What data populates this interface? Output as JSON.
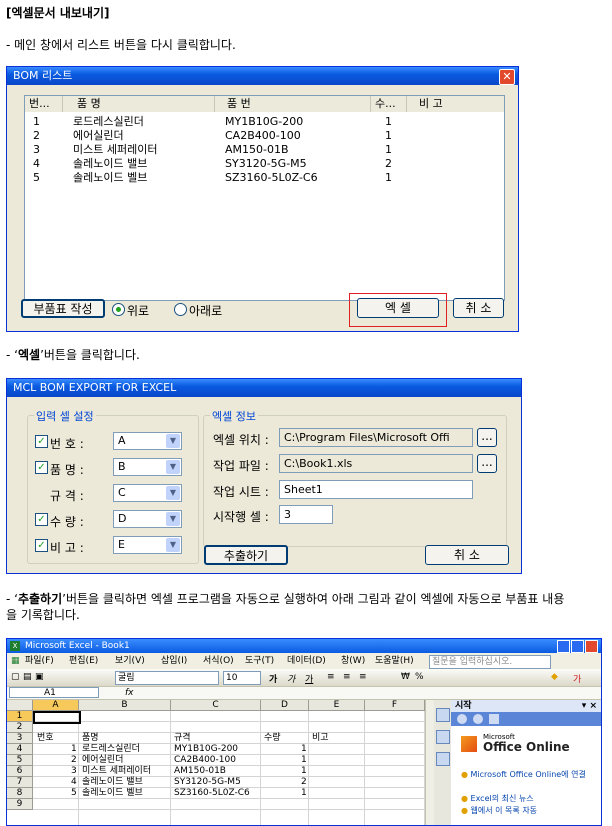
{
  "sec1_heading": "[엑셀문서 내보내기]",
  "step1": "- 메인 창에서 리스트 버튼을 다시 클릭합니다.",
  "bom": {
    "title": "BOM 리스트",
    "close": "✕",
    "headers": [
      "번...",
      "품  명",
      "품  번",
      "수...",
      "비  고"
    ],
    "rows": [
      {
        "no": "1",
        "name": "로드레스실린더",
        "part": "MY1B10G-200",
        "qty": "1"
      },
      {
        "no": "2",
        "name": "에어실린더",
        "part": "CA2B400-100",
        "qty": "1"
      },
      {
        "no": "3",
        "name": "미스트 세퍼레이터",
        "part": "AM150-01B",
        "qty": "1"
      },
      {
        "no": "4",
        "name": "솔레노이드 밸브",
        "part": "SY3120-5G-M5",
        "qty": "2"
      },
      {
        "no": "5",
        "name": "솔레노이드 벨브",
        "part": "SZ3160-5L0Z-C6",
        "qty": "1"
      }
    ],
    "btn_parts": "부품표 작성",
    "radio_up": "위로",
    "radio_down": "아래로",
    "btn_excel": "엑  셀",
    "btn_cancel": "취  소"
  },
  "step2_prefix": "- ‘",
  "step2_bold": "엑셀",
  "step2_suffix": "’버튼을 클릭합니다.",
  "export": {
    "title": "MCL BOM EXPORT FOR EXCEL",
    "group_input": "입력 셀 설정",
    "group_excel": "엑셀 정보",
    "fields": [
      {
        "label": "번    호 :",
        "value": "A",
        "checked": true
      },
      {
        "label": "품    명 :",
        "value": "B",
        "checked": true
      },
      {
        "label": "규    격 :",
        "value": "C",
        "checked": false
      },
      {
        "label": "수    량 :",
        "value": "D",
        "checked": true
      },
      {
        "label": "비    고 :",
        "value": "E",
        "checked": true
      }
    ],
    "excel_loc_label": "엑셀 위치 :",
    "excel_loc_value": "C:\\Program Files\\Microsoft Offi",
    "work_file_label": "작업 파일 :",
    "work_file_value": "C:\\Book1.xls",
    "work_sheet_label": "작업 시트 :",
    "work_sheet_value": "Sheet1",
    "start_row_label": "시작행 셀 :",
    "start_row_value": "3",
    "browse": "...",
    "btn_extract": "추출하기",
    "btn_cancel": "취    소"
  },
  "step3_prefix": "- ‘",
  "step3_bold": "추출하기",
  "step3_suffix": "’버튼을 클릭하면 엑셀 프로그램을 자동으로 실행하여 아래 그림과 같이 엑셀에 자동으로 부품표 내용",
  "step3_line2": "을 기록합니다.",
  "excel": {
    "title": "Microsoft Excel - Book1",
    "menus": [
      "파일(F)",
      "편집(E)",
      "보기(V)",
      "삽입(I)",
      "서식(O)",
      "도구(T)",
      "데이터(D)",
      "창(W)",
      "도움말(H)"
    ],
    "help_placeholder": "질문을 입력하십시오.",
    "font": "굴림",
    "size": "10",
    "namebox": "A1",
    "fx": "fx",
    "cols": [
      "A",
      "B",
      "C",
      "D",
      "E",
      "F"
    ],
    "rownums": [
      "1",
      "2",
      "3",
      "4",
      "5",
      "6",
      "7",
      "8",
      "9"
    ],
    "header_row": [
      "번호",
      "품명",
      "규격",
      "수량",
      "비고"
    ],
    "data": [
      {
        "no": "1",
        "name": "로드레스실린더",
        "part": "MY1B10G-200",
        "qty": "1"
      },
      {
        "no": "2",
        "name": "에어실린더",
        "part": "CA2B400-100",
        "qty": "1"
      },
      {
        "no": "3",
        "name": "미스트 세퍼레이터",
        "part": "AM150-01B",
        "qty": "1"
      },
      {
        "no": "4",
        "name": "솔레노이드 밸브",
        "part": "SY3120-5G-M5",
        "qty": "2"
      },
      {
        "no": "5",
        "name": "솔레노이드 벨브",
        "part": "SZ3160-5L0Z-C6",
        "qty": "1"
      }
    ],
    "taskpane_title": "시작",
    "office_online_small": "Microsoft",
    "office_online": "Office Online",
    "tp_link1": "Microsoft Office Online에 연결",
    "tp_link2": "Excel의 최신 뉴스",
    "tp_link3": "웹에서 이 목록 자동"
  }
}
